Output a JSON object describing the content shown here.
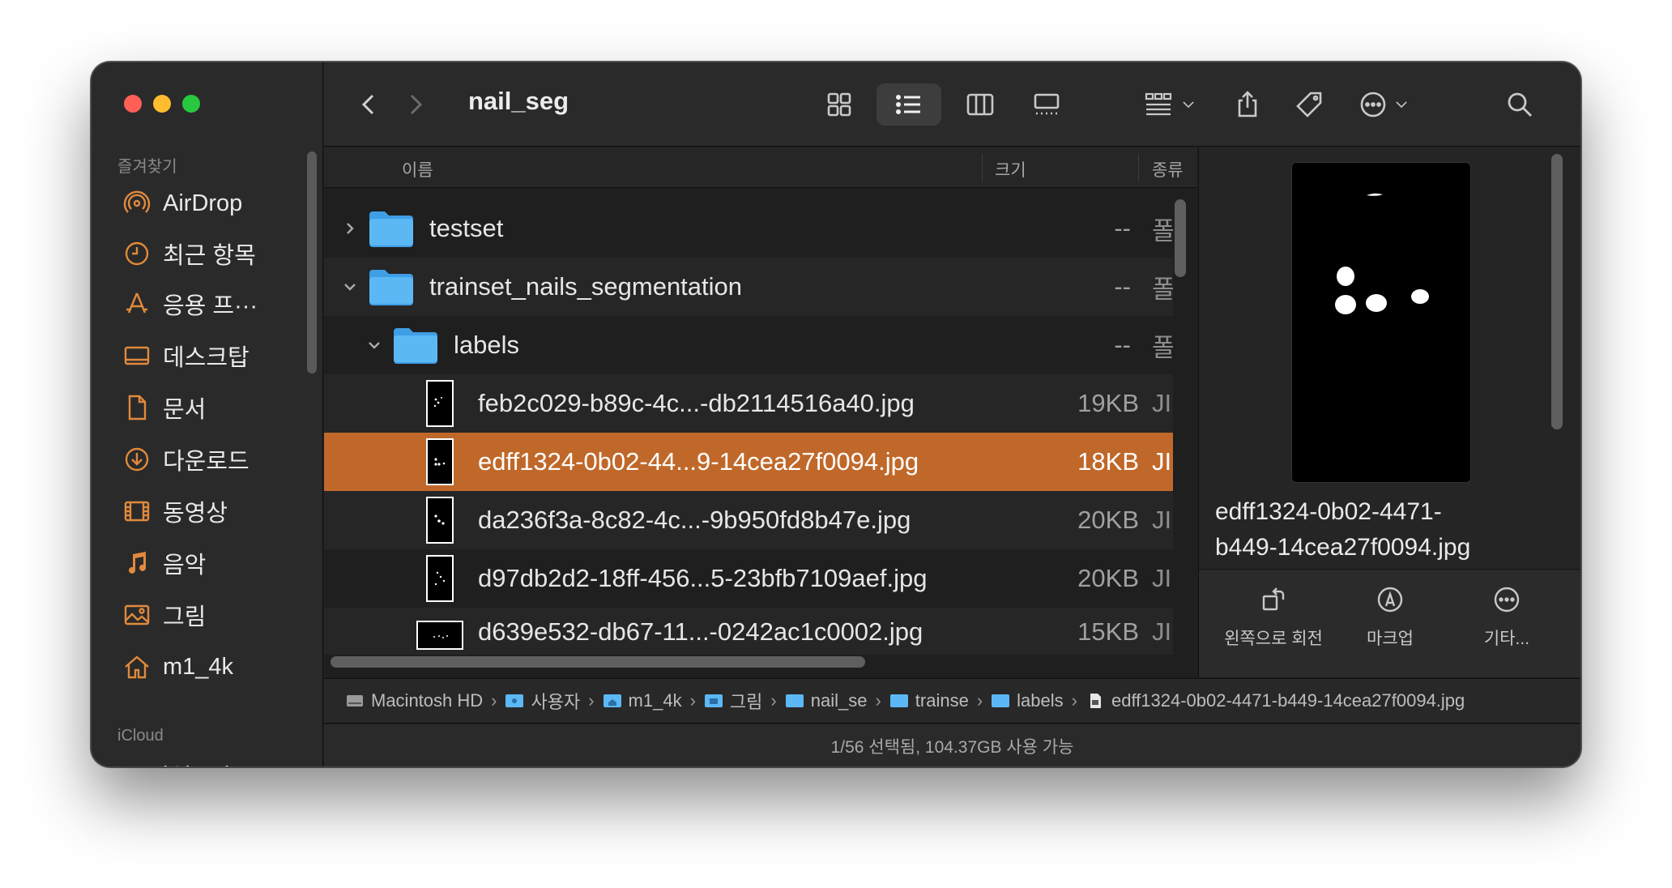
{
  "window": {
    "title": "nail_seg"
  },
  "sidebar": {
    "favorites_label": "즐겨찾기",
    "icloud_label": "iCloud",
    "items": [
      {
        "label": "AirDrop",
        "icon": "airdrop-icon"
      },
      {
        "label": "최근 항목",
        "icon": "clock-icon"
      },
      {
        "label": "응용 프···",
        "icon": "applications-icon"
      },
      {
        "label": "데스크탑",
        "icon": "desktop-icon"
      },
      {
        "label": "문서",
        "icon": "document-icon"
      },
      {
        "label": "다운로드",
        "icon": "download-icon"
      },
      {
        "label": "동영상",
        "icon": "film-icon"
      },
      {
        "label": "음악",
        "icon": "music-icon"
      },
      {
        "label": "그림",
        "icon": "picture-icon"
      },
      {
        "label": "m1_4k",
        "icon": "home-icon"
      }
    ],
    "icloud_partial": "iCloud"
  },
  "columns": {
    "name": "이름",
    "size": "크기",
    "kind": "종류"
  },
  "rows": [
    {
      "name": "testset",
      "size": "--",
      "kind": "폴",
      "type": "folder",
      "expanded": false
    },
    {
      "name": "trainset_nails_segmentation",
      "size": "--",
      "kind": "폴",
      "type": "folder",
      "expanded": true
    },
    {
      "name": "labels",
      "size": "--",
      "kind": "폴",
      "type": "folder",
      "expanded": true
    },
    {
      "name": "feb2c029-b89c-4c...-db2114516a40.jpg",
      "size": "19KB",
      "kind": "JI",
      "type": "image"
    },
    {
      "name": "edff1324-0b02-44...9-14cea27f0094.jpg",
      "size": "18KB",
      "kind": "JI",
      "type": "image",
      "selected": true
    },
    {
      "name": "da236f3a-8c82-4c...-9b950fd8b47e.jpg",
      "size": "20KB",
      "kind": "JI",
      "type": "image"
    },
    {
      "name": "d97db2d2-18ff-456...5-23bfb7109aef.jpg",
      "size": "20KB",
      "kind": "JI",
      "type": "image"
    },
    {
      "name": "d639e532-db67-11...-0242ac1c0002.jpg",
      "size": "15KB",
      "kind": "JI",
      "type": "image-landscape"
    }
  ],
  "preview": {
    "filename": "edff1324-0b02-4471-b449-14cea27f0094.jpg",
    "filename_line1": "edff1324-0b02-4471-",
    "filename_line2": "b449-14cea27f0094.jpg",
    "actions": [
      {
        "label": "왼쪽으로 회전",
        "icon": "rotate-left-icon"
      },
      {
        "label": "마크업",
        "icon": "markup-icon"
      },
      {
        "label": "기타...",
        "icon": "more-icon"
      }
    ]
  },
  "pathbar": [
    {
      "label": "Macintosh HD",
      "icon": "hard-drive-icon"
    },
    {
      "label": "사용자",
      "icon": "folder-icon"
    },
    {
      "label": "m1_4k",
      "icon": "home-folder-icon"
    },
    {
      "label": "그림",
      "icon": "folder-icon"
    },
    {
      "label": "nail_se",
      "icon": "folder-icon"
    },
    {
      "label": "trainse",
      "icon": "folder-icon"
    },
    {
      "label": "labels",
      "icon": "folder-icon"
    },
    {
      "label": "edff1324-0b02-4471-b449-14cea27f0094.jpg",
      "icon": "file-icon"
    }
  ],
  "status": "1/56 선택됨, 104.37GB 사용 가능",
  "colors": {
    "selection": "#c0682a",
    "accent_sidebar_icon": "#e08a3c",
    "folder_blue": "#5cb8f5"
  }
}
